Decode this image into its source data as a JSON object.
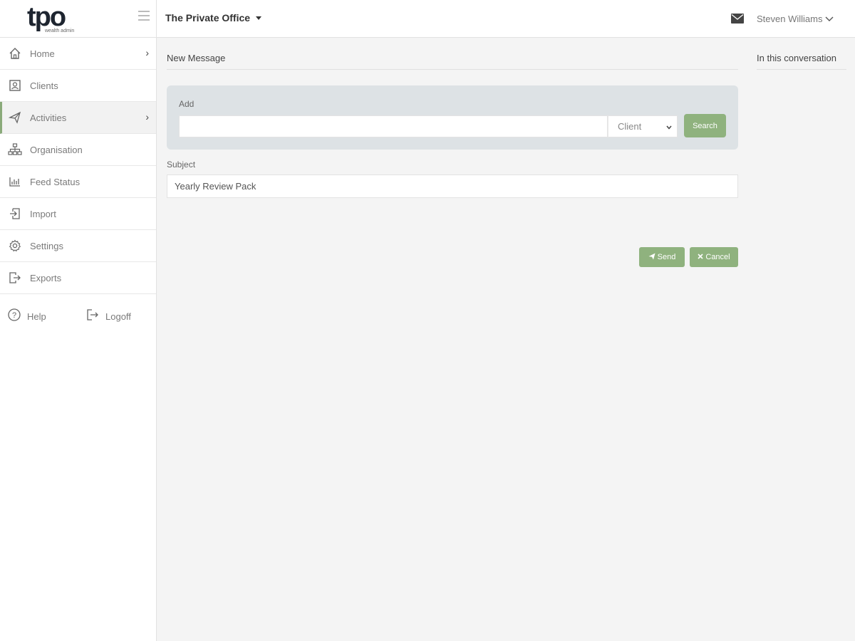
{
  "logo": {
    "text": "tpo",
    "subtext": "wealth admin"
  },
  "header": {
    "org_name": "The Private Office",
    "user_name": "Steven Williams"
  },
  "sidebar": {
    "items": [
      {
        "label": "Home",
        "icon": "home-icon",
        "chevron": "›"
      },
      {
        "label": "Clients",
        "icon": "clients-icon"
      },
      {
        "label": "Activities",
        "icon": "paper-plane-icon",
        "chevron": "›",
        "active": true
      },
      {
        "label": "Organisation",
        "icon": "org-chart-icon"
      },
      {
        "label": "Feed Status",
        "icon": "chart-icon"
      },
      {
        "label": "Import",
        "icon": "import-icon"
      },
      {
        "label": "Settings",
        "icon": "gear-icon"
      },
      {
        "label": "Exports",
        "icon": "export-icon"
      }
    ],
    "help_label": "Help",
    "logoff_label": "Logoff"
  },
  "main": {
    "title": "New Message",
    "conversation_title": "In this conversation",
    "add": {
      "label": "Add",
      "input_value": "",
      "type_value": "Client",
      "search_label": "Search"
    },
    "subject": {
      "label": "Subject",
      "value": "Yearly Review Pack"
    },
    "send_label": "Send",
    "cancel_label": "Cancel"
  },
  "colors": {
    "accent": "#8fb27e",
    "panel": "#dde2e5",
    "background": "#f4f4f4"
  }
}
